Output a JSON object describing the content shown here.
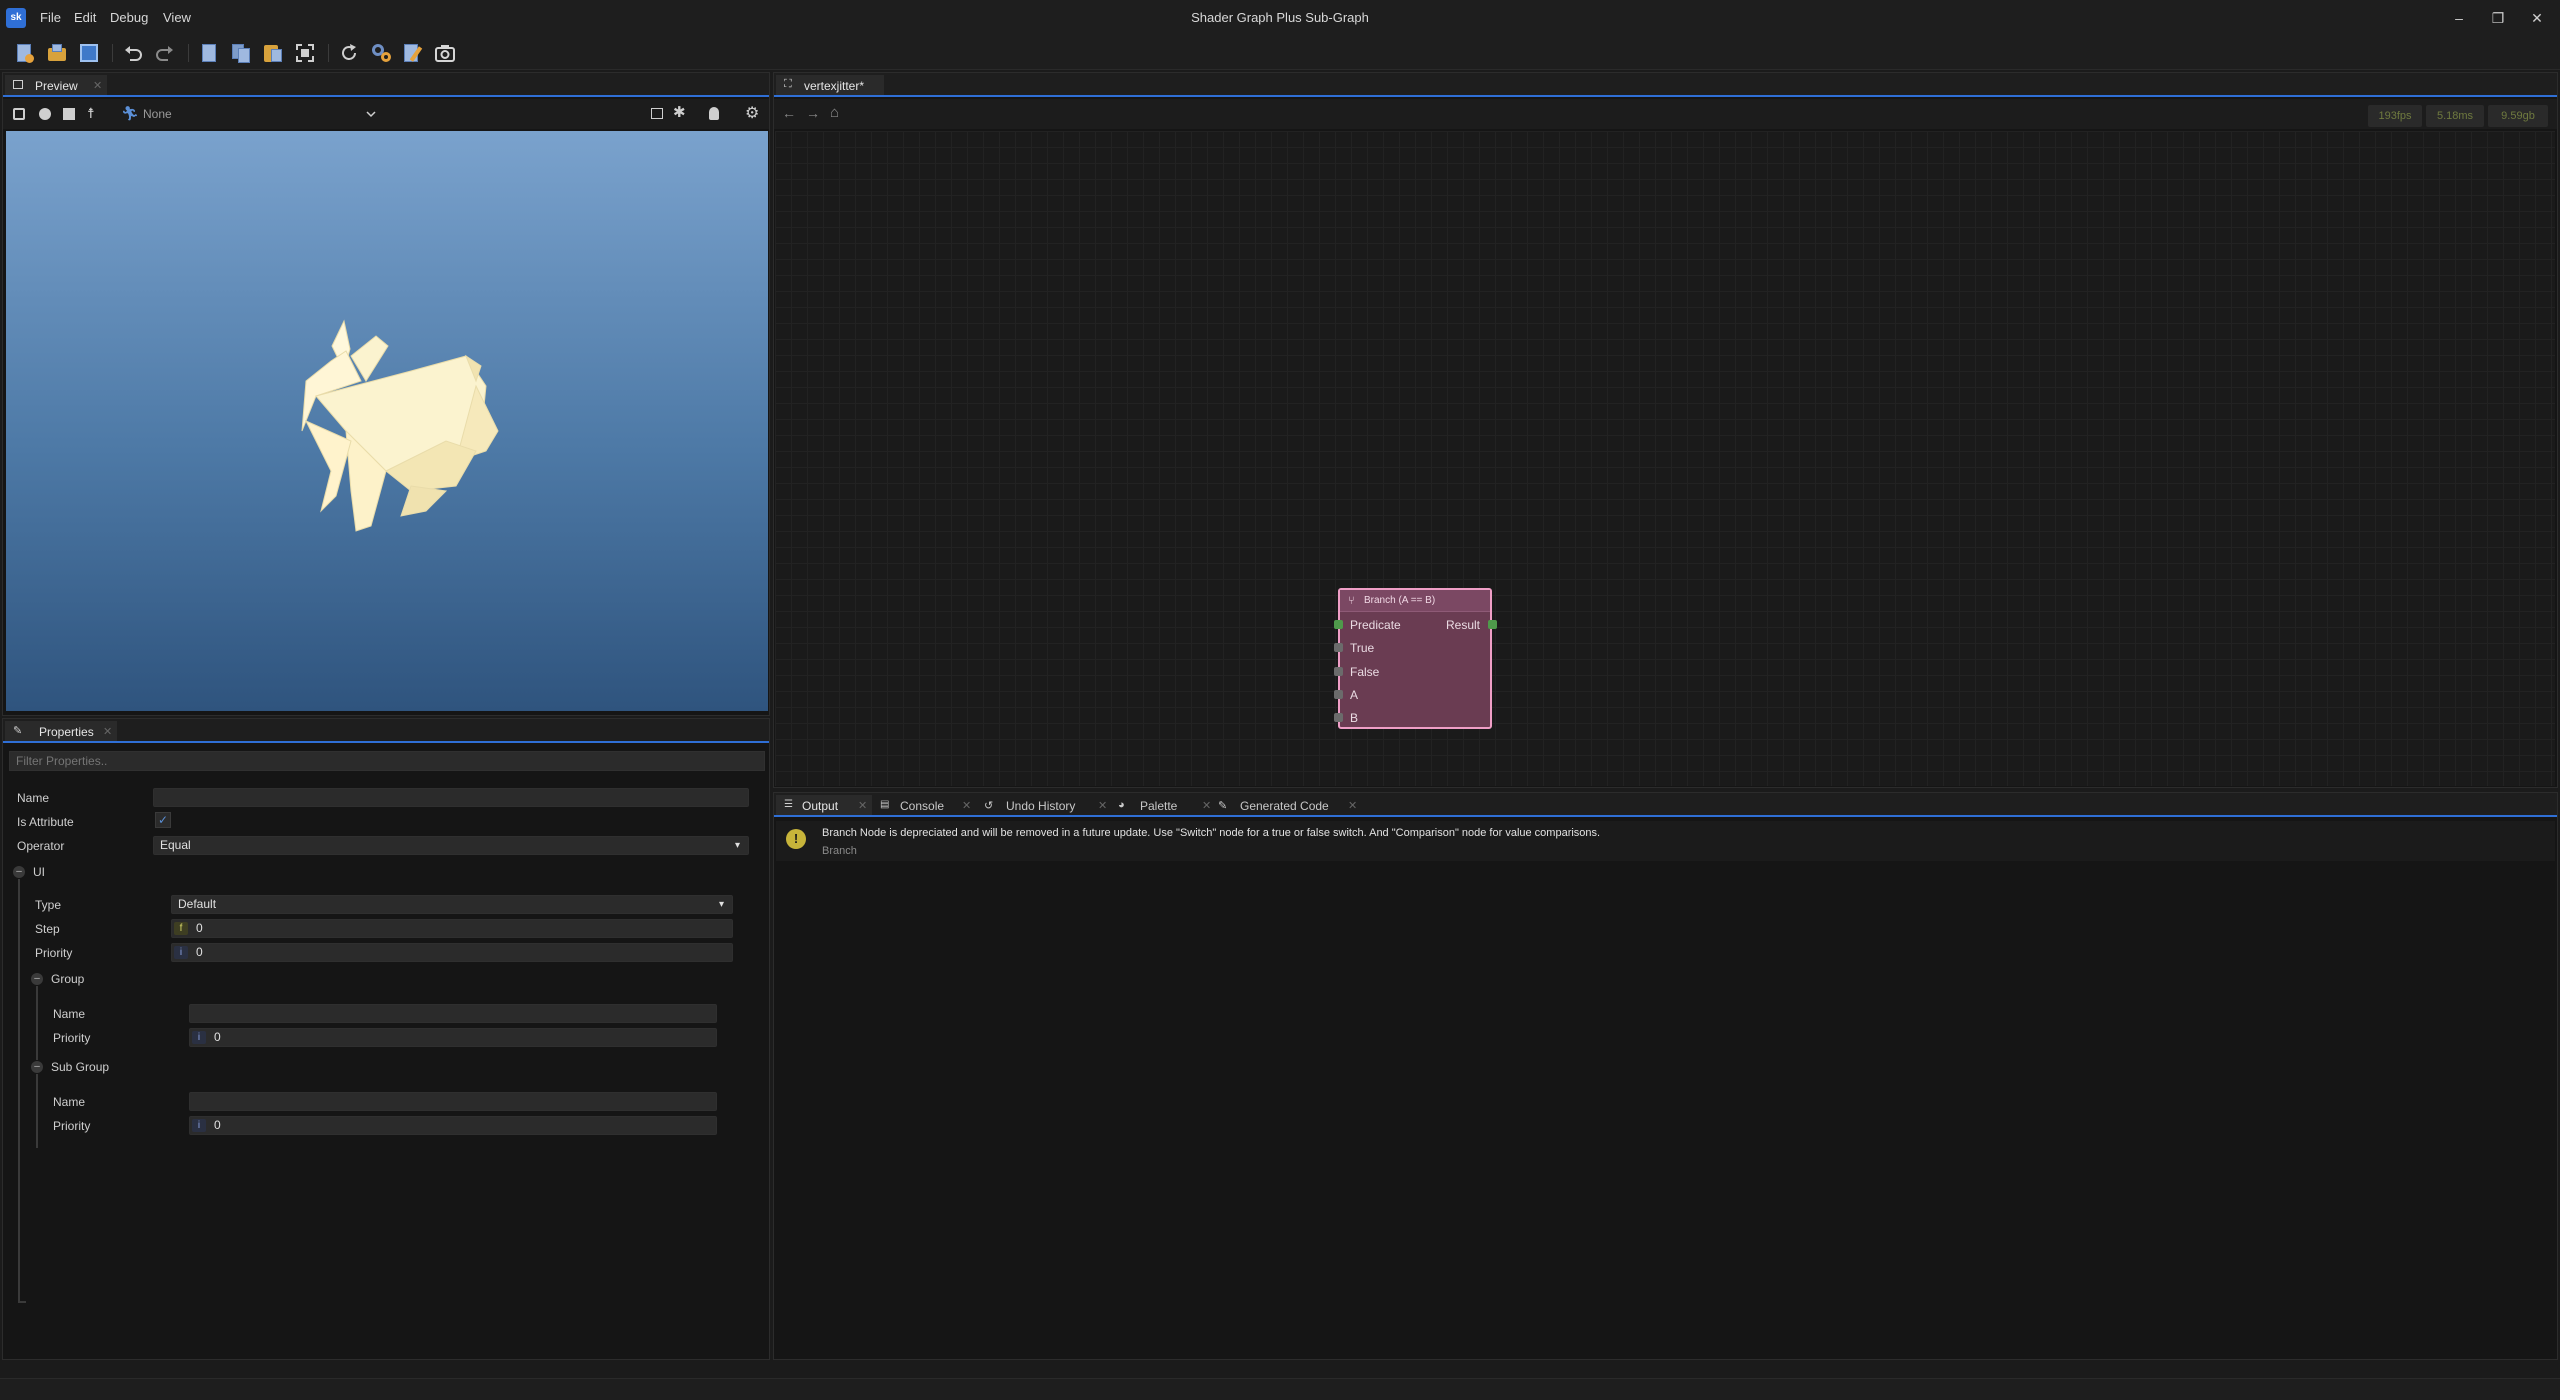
{
  "app": {
    "logo": "sk",
    "title": "Shader Graph Plus Sub-Graph"
  },
  "menu": [
    "File",
    "Edit",
    "Debug",
    "View"
  ],
  "window_controls": {
    "minimize": "–",
    "maximize": "❐",
    "close": "✕"
  },
  "preview": {
    "tab_label": "Preview",
    "animation_select": "None",
    "model": "rabbit"
  },
  "properties": {
    "tab_label": "Properties",
    "filter_placeholder": "Filter Properties..",
    "name_label": "Name",
    "name_value": "",
    "is_attribute_label": "Is Attribute",
    "is_attribute_checked": true,
    "operator_label": "Operator",
    "operator_value": "Equal",
    "ui_section": "UI",
    "type_label": "Type",
    "type_value": "Default",
    "step_label": "Step",
    "step_badge": "f",
    "step_value": "0",
    "priority_label": "Priority",
    "priority_badge": "i",
    "priority_value": "0",
    "group_section": "Group",
    "group_name_label": "Name",
    "group_name_value": "",
    "group_priority_label": "Priority",
    "group_priority_badge": "i",
    "group_priority_value": "0",
    "subgroup_section": "Sub Group",
    "subgroup_name_label": "Name",
    "subgroup_name_value": "",
    "subgroup_priority_label": "Priority",
    "subgroup_priority_badge": "i",
    "subgroup_priority_value": "0"
  },
  "graph": {
    "tab_label": "vertexjitter*",
    "stats": {
      "fps": "193fps",
      "ms": "5.18ms",
      "mem": "9.59gb"
    },
    "node": {
      "title": "Branch (A == B)",
      "inputs": [
        "Predicate",
        "True",
        "False",
        "A",
        "B"
      ],
      "output": "Result"
    }
  },
  "bottom_tabs": [
    "Output",
    "Console",
    "Undo History",
    "Palette",
    "Generated Code"
  ],
  "output": {
    "message": "Branch Node is depreciated and will be removed in a future update. Use \"Switch\" node for a true or false switch. And \"Comparison\" node for value comparisons.",
    "source": "Branch"
  }
}
